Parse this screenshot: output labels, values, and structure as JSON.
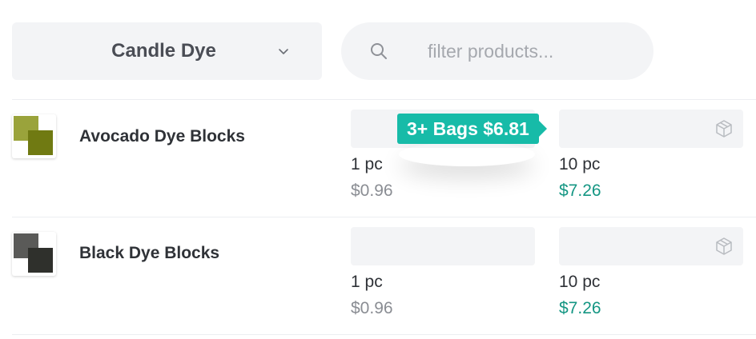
{
  "category": {
    "selected": "Candle Dye",
    "icon": "chevron-down-icon"
  },
  "search": {
    "placeholder": "filter products...",
    "value": "",
    "icon": "search-icon"
  },
  "colors": {
    "accent": "#17bba8",
    "bulk_price": "#149683",
    "muted_price": "#8a8d93",
    "surface": "#f3f4f6"
  },
  "products": [
    {
      "name": "Avocado Dye Blocks",
      "thumb": {
        "color_a": "#9aa33b",
        "color_b": "#707a12"
      },
      "options": [
        {
          "qty": "1 pc",
          "price": "$0.96"
        },
        {
          "qty": "10 pc",
          "price": "$7.26"
        }
      ],
      "deal": "3+ Bags $6.81"
    },
    {
      "name": "Black Dye Blocks",
      "thumb": {
        "color_a": "#5a5a58",
        "color_b": "#2f302c"
      },
      "options": [
        {
          "qty": "1 pc",
          "price": "$0.96"
        },
        {
          "qty": "10 pc",
          "price": "$7.26"
        }
      ]
    }
  ]
}
